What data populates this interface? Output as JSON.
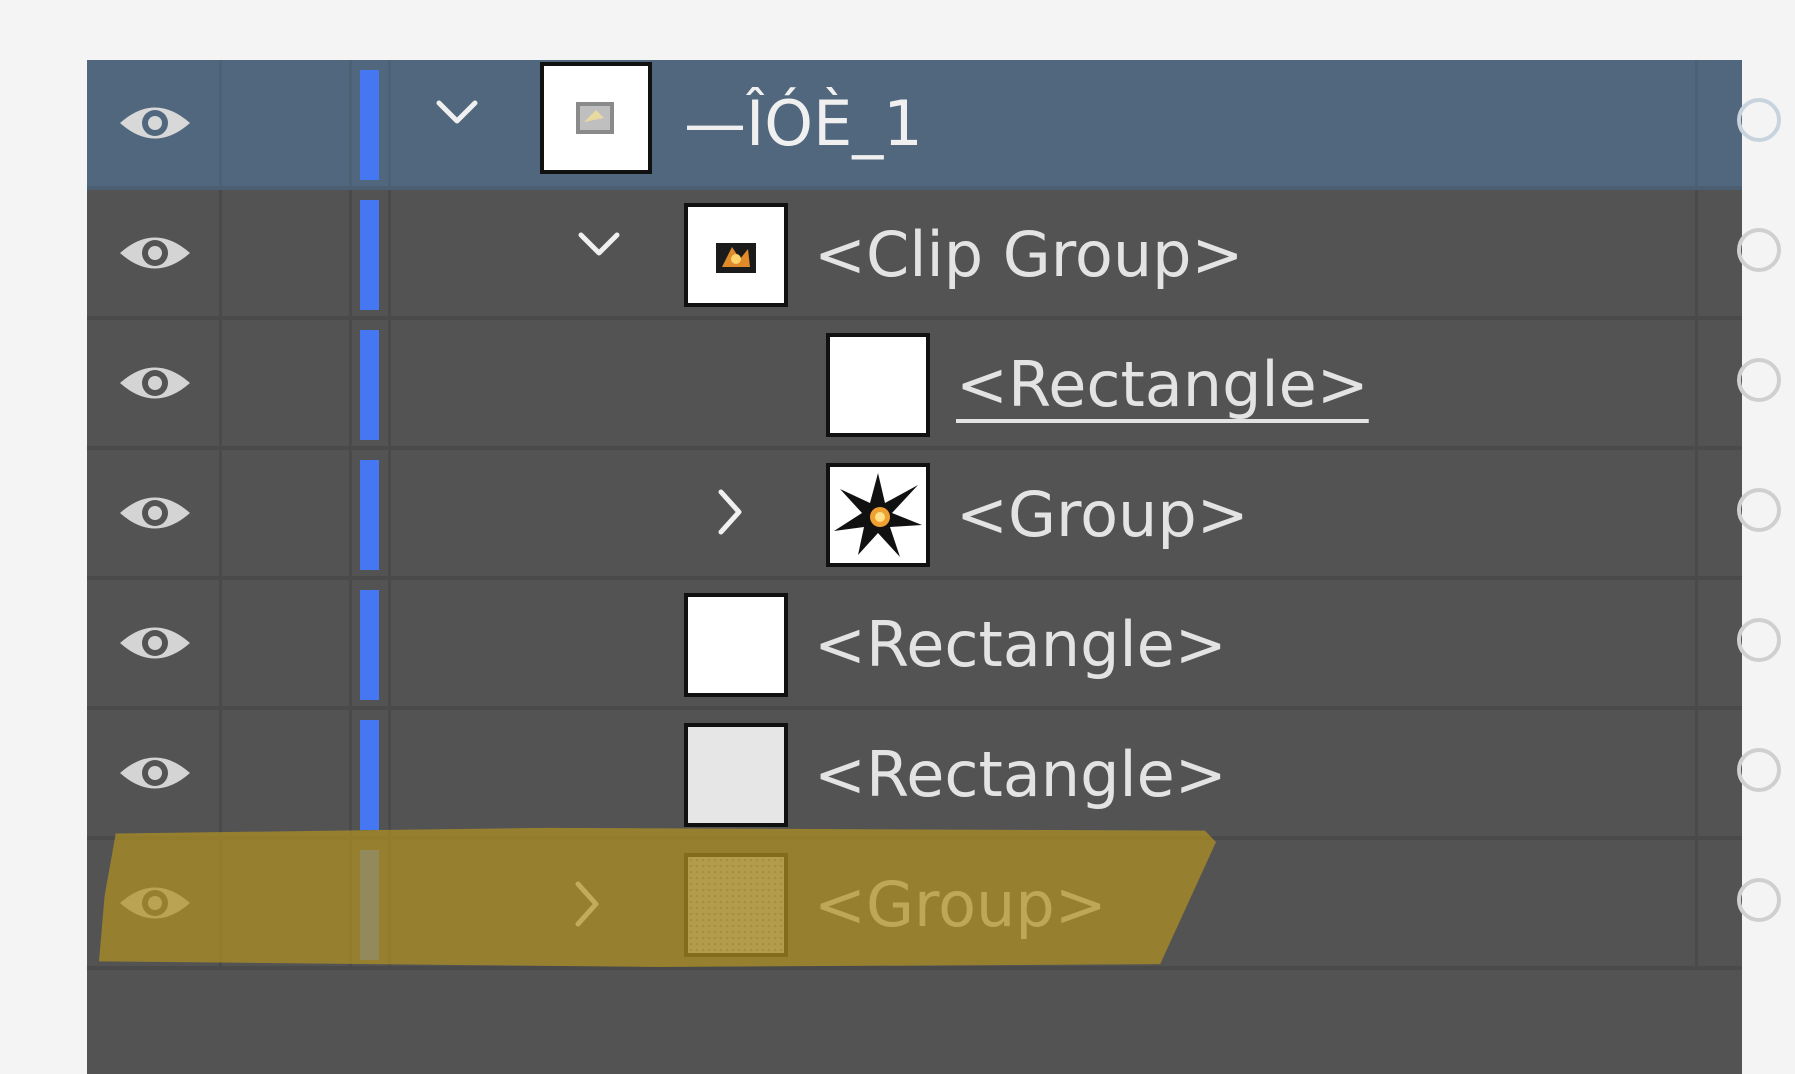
{
  "layers_panel": {
    "rows": [
      {
        "label": "—ÎÓÈ_1",
        "selected": true,
        "expanded": true,
        "disclosure": "chevron-down-icon",
        "thumbnail": "layer-thumbnail"
      },
      {
        "label": "<Clip Group>",
        "selected": false,
        "expanded": true,
        "disclosure": "chevron-down-icon",
        "thumbnail": "explosion-thumbnail"
      },
      {
        "label": "<Rectangle>",
        "selected": false,
        "underlined": true,
        "thumbnail": "white-rectangle-thumbnail"
      },
      {
        "label": "<Group>",
        "selected": false,
        "expanded": false,
        "disclosure": "chevron-right-icon",
        "thumbnail": "starburst-thumbnail"
      },
      {
        "label": "<Rectangle>",
        "selected": false,
        "thumbnail": "white-rectangle-thumbnail"
      },
      {
        "label": "<Rectangle>",
        "selected": false,
        "thumbnail": "light-gray-rectangle-thumbnail"
      },
      {
        "label": "<Group>",
        "selected": false,
        "expanded": false,
        "highlighted": true,
        "disclosure": "chevron-right-icon",
        "thumbnail": "pattern-thumbnail"
      }
    ],
    "layer_color": "#4677f2",
    "selected_row_color": "#51677e",
    "highlight_color": "#b09122"
  }
}
